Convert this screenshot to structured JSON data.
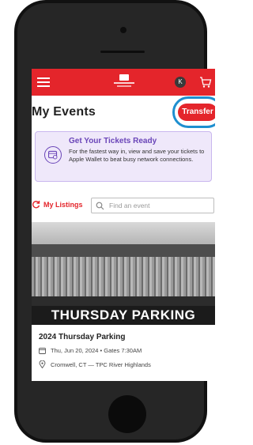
{
  "header": {
    "menu_icon": "hamburger-icon",
    "logo_icon": "ticket-logo",
    "avatar_initial": "K",
    "cart_icon": "cart-icon"
  },
  "page": {
    "title": "My Events",
    "transfer_label": "Transfer"
  },
  "banner": {
    "title": "Get Your Tickets Ready",
    "text": "For the fastest way in, view and save your tickets to Apple Wallet to beat busy network connections."
  },
  "listings": {
    "label": "My Listings",
    "search_placeholder": "Find an event"
  },
  "event": {
    "image_caption": "THURSDAY PARKING",
    "name": "2024 Thursday Parking",
    "date": "Thu, Jun 20, 2024 • Gates 7:30AM",
    "location": "Cromwell, CT — TPC River Highlands"
  },
  "colors": {
    "brand_red": "#e4252b",
    "banner_purple": "#6a45b8",
    "highlight_blue": "#1e8fd0"
  }
}
